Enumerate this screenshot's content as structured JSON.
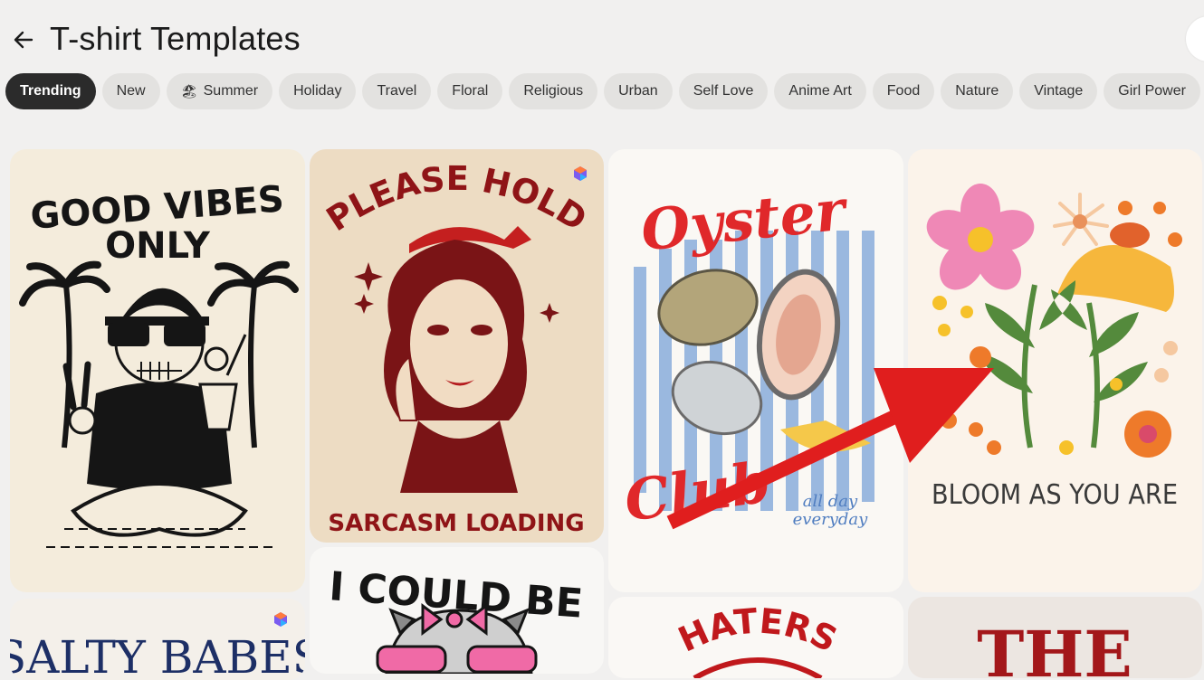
{
  "header": {
    "title": "T-shirt Templates"
  },
  "chips": [
    {
      "label": "Trending",
      "active": true
    },
    {
      "label": "New"
    },
    {
      "label": "Summer",
      "emoji": "🏖"
    },
    {
      "label": "Holiday"
    },
    {
      "label": "Travel"
    },
    {
      "label": "Floral"
    },
    {
      "label": "Religious"
    },
    {
      "label": "Urban"
    },
    {
      "label": "Self Love"
    },
    {
      "label": "Anime Art"
    },
    {
      "label": "Food"
    },
    {
      "label": "Nature"
    },
    {
      "label": "Vintage"
    },
    {
      "label": "Girl Power"
    }
  ],
  "cards": {
    "good_vibes": {
      "line1": "GOOD VIBES",
      "line2": "ONLY"
    },
    "please_hold": {
      "top": "PLEASE HOLD",
      "bottom": "SARCASM LOADING"
    },
    "oyster": {
      "top": "Oyster",
      "bottom": "Club",
      "tagline1": "all day",
      "tagline2": "everyday"
    },
    "bloom": {
      "text": "BLOOM AS YOU ARE"
    },
    "salty": {
      "text": "SALTY BABES"
    },
    "could_be": {
      "text": "I COULD BE"
    },
    "haters": {
      "text": "HATERS"
    },
    "the": {
      "text": "THE"
    }
  },
  "colors": {
    "accent_red": "#e01e1e",
    "chip_active": "#2b2b2b",
    "chip_bg": "#e3e2e0"
  }
}
